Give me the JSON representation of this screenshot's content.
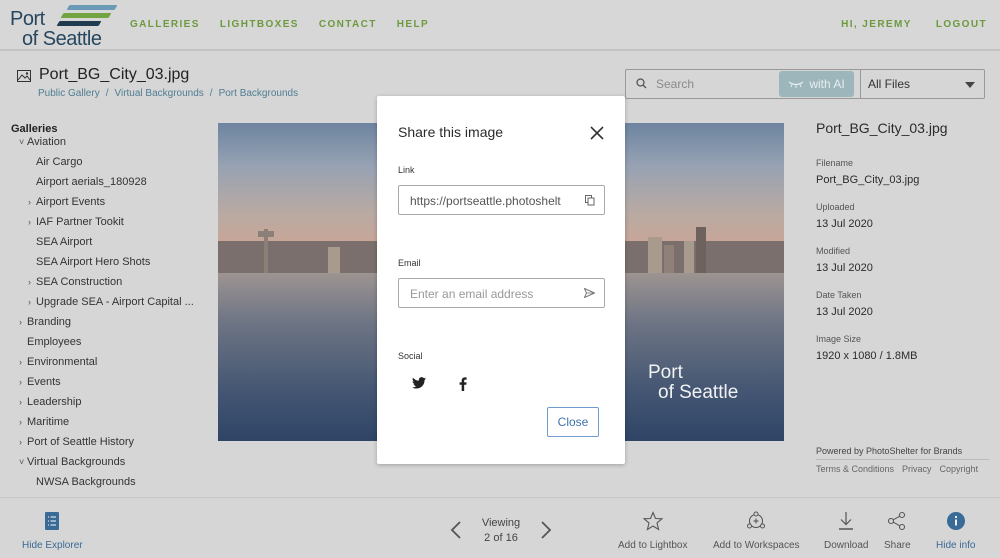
{
  "header": {
    "logo": {
      "line1": "Port",
      "line2": "of Seattle",
      "stripe_colors": [
        "#6a9ab5",
        "#72a442",
        "#1f3b4f"
      ]
    },
    "nav": [
      {
        "label": "GALLERIES"
      },
      {
        "label": "LIGHTBOXES"
      },
      {
        "label": "CONTACT"
      },
      {
        "label": "HELP"
      }
    ],
    "greeting": "HI, JEREMY",
    "logout": "LOGOUT",
    "accent_color": "#6d9a3f"
  },
  "page": {
    "title": "Port_BG_City_03.jpg",
    "title_icon": "image-icon",
    "breadcrumb": [
      "Public Gallery",
      "Virtual Backgrounds",
      "Port Backgrounds"
    ]
  },
  "search": {
    "placeholder": "Search",
    "ai_button": "with AI",
    "filter": "All Files"
  },
  "sidebar": {
    "heading": "Galleries",
    "items": [
      {
        "label": "Aviation",
        "chevron": "open",
        "level": 1
      },
      {
        "label": "Air Cargo",
        "chevron": "",
        "level": 2
      },
      {
        "label": "Airport aerials_180928",
        "chevron": "",
        "level": 2
      },
      {
        "label": "Airport Events",
        "chevron": "closed",
        "level": 2
      },
      {
        "label": "IAF Partner Tookit",
        "chevron": "closed",
        "level": 2
      },
      {
        "label": "SEA Airport",
        "chevron": "",
        "level": 2
      },
      {
        "label": "SEA Airport Hero Shots",
        "chevron": "",
        "level": 2
      },
      {
        "label": "SEA Construction",
        "chevron": "closed",
        "level": 2
      },
      {
        "label": "Upgrade SEA - Airport Capital ...",
        "chevron": "closed",
        "level": 2
      },
      {
        "label": "Branding",
        "chevron": "closed",
        "level": 1
      },
      {
        "label": "Employees",
        "chevron": "",
        "level": 1
      },
      {
        "label": "Environmental",
        "chevron": "closed",
        "level": 1
      },
      {
        "label": "Events",
        "chevron": "closed",
        "level": 1
      },
      {
        "label": "Leadership",
        "chevron": "closed",
        "level": 1
      },
      {
        "label": "Maritime",
        "chevron": "closed",
        "level": 1
      },
      {
        "label": "Port of Seattle History",
        "chevron": "closed",
        "level": 1
      },
      {
        "label": "Virtual Backgrounds",
        "chevron": "open",
        "level": 1
      },
      {
        "label": "NWSA Backgrounds",
        "chevron": "",
        "level": 2
      }
    ]
  },
  "photo": {
    "watermark_line1": "Port",
    "watermark_line2": "of Seattle"
  },
  "info": {
    "title": "Port_BG_City_03.jpg",
    "fields": [
      {
        "label": "Filename",
        "value": "Port_BG_City_03.jpg"
      },
      {
        "label": "Uploaded",
        "value": "13 Jul 2020"
      },
      {
        "label": "Modified",
        "value": "13 Jul 2020"
      },
      {
        "label": "Date Taken",
        "value": "13 Jul 2020"
      },
      {
        "label": "Image Size",
        "value": "1920 x 1080 / 1.8MB"
      }
    ],
    "powered_by": "Powered by PhotoShelter for Brands",
    "links": [
      "Terms & Conditions",
      "Privacy",
      "Copyright"
    ]
  },
  "toolbar": {
    "hide_explorer": "Hide Explorer",
    "viewing_label": "Viewing",
    "viewing_count": "2 of 16",
    "add_lightbox": "Add to Lightbox",
    "add_workspaces": "Add to Workspaces",
    "download": "Download",
    "share": "Share",
    "hide_info": "Hide info",
    "active_color": "#3a6a96"
  },
  "modal": {
    "title": "Share this image",
    "link_label": "Link",
    "link_value": "https://portseattle.photoshelt",
    "email_label": "Email",
    "email_placeholder": "Enter an email address",
    "social_label": "Social",
    "social": [
      "twitter-icon",
      "facebook-icon"
    ],
    "close_button": "Close",
    "button_color": "#3d73ad"
  }
}
